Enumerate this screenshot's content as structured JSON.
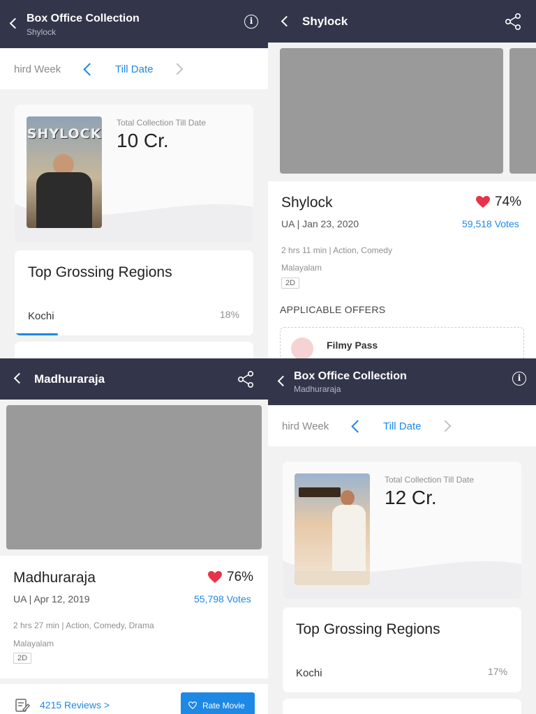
{
  "shylock_collection": {
    "header": {
      "title": "Box Office Collection",
      "subtitle": "Shylock"
    },
    "tabs": {
      "previous": "hird Week",
      "current": "Till Date"
    },
    "summary": {
      "label": "Total Collection Till Date",
      "value": "10 Cr.",
      "poster_text": "SHYLOCK"
    },
    "regions": {
      "title": "Top Grossing Regions",
      "top": {
        "name": "Kochi",
        "share": "18%"
      }
    }
  },
  "shylock_details": {
    "header": {
      "title": "Shylock"
    },
    "movie": {
      "name": "Shylock",
      "rating": "74%",
      "certificate_date": "UA | Jan 23, 2020",
      "votes": "59,518 Votes",
      "duration_genre": "2 hrs 11 min | Action, Comedy",
      "language": "Malayalam",
      "format": "2D"
    },
    "offers": {
      "title": "APPLICABLE OFFERS",
      "first": "Filmy Pass"
    }
  },
  "madhuraraja_details": {
    "header": {
      "title": "Madhuraraja"
    },
    "movie": {
      "name": "Madhuraraja",
      "rating": "76%",
      "certificate_date": "UA | Apr 12, 2019",
      "votes": "55,798 Votes",
      "duration_genre": "2 hrs 27 min | Action, Comedy, Drama",
      "language": "Malayalam",
      "format": "2D"
    },
    "footer": {
      "reviews": "4215 Reviews >",
      "rate_button": "Rate Movie"
    }
  },
  "madhuraraja_collection": {
    "header": {
      "title": "Box Office Collection",
      "subtitle": "Madhuraraja"
    },
    "tabs": {
      "previous": "hird Week",
      "current": "Till Date"
    },
    "summary": {
      "label": "Total Collection Till Date",
      "value": "12 Cr."
    },
    "regions": {
      "title": "Top Grossing Regions",
      "top": {
        "name": "Kochi",
        "share": "17%"
      }
    }
  },
  "colors": {
    "header_bg": "#33364a",
    "accent": "#1e88e5",
    "heart": "#e8334a",
    "placeholder": "#9a9a9a"
  },
  "icons": [
    "back-arrow-icon",
    "info-icon",
    "share-icon",
    "chevron-left-icon",
    "chevron-right-icon",
    "heart-icon",
    "offer-icon",
    "review-icon"
  ]
}
